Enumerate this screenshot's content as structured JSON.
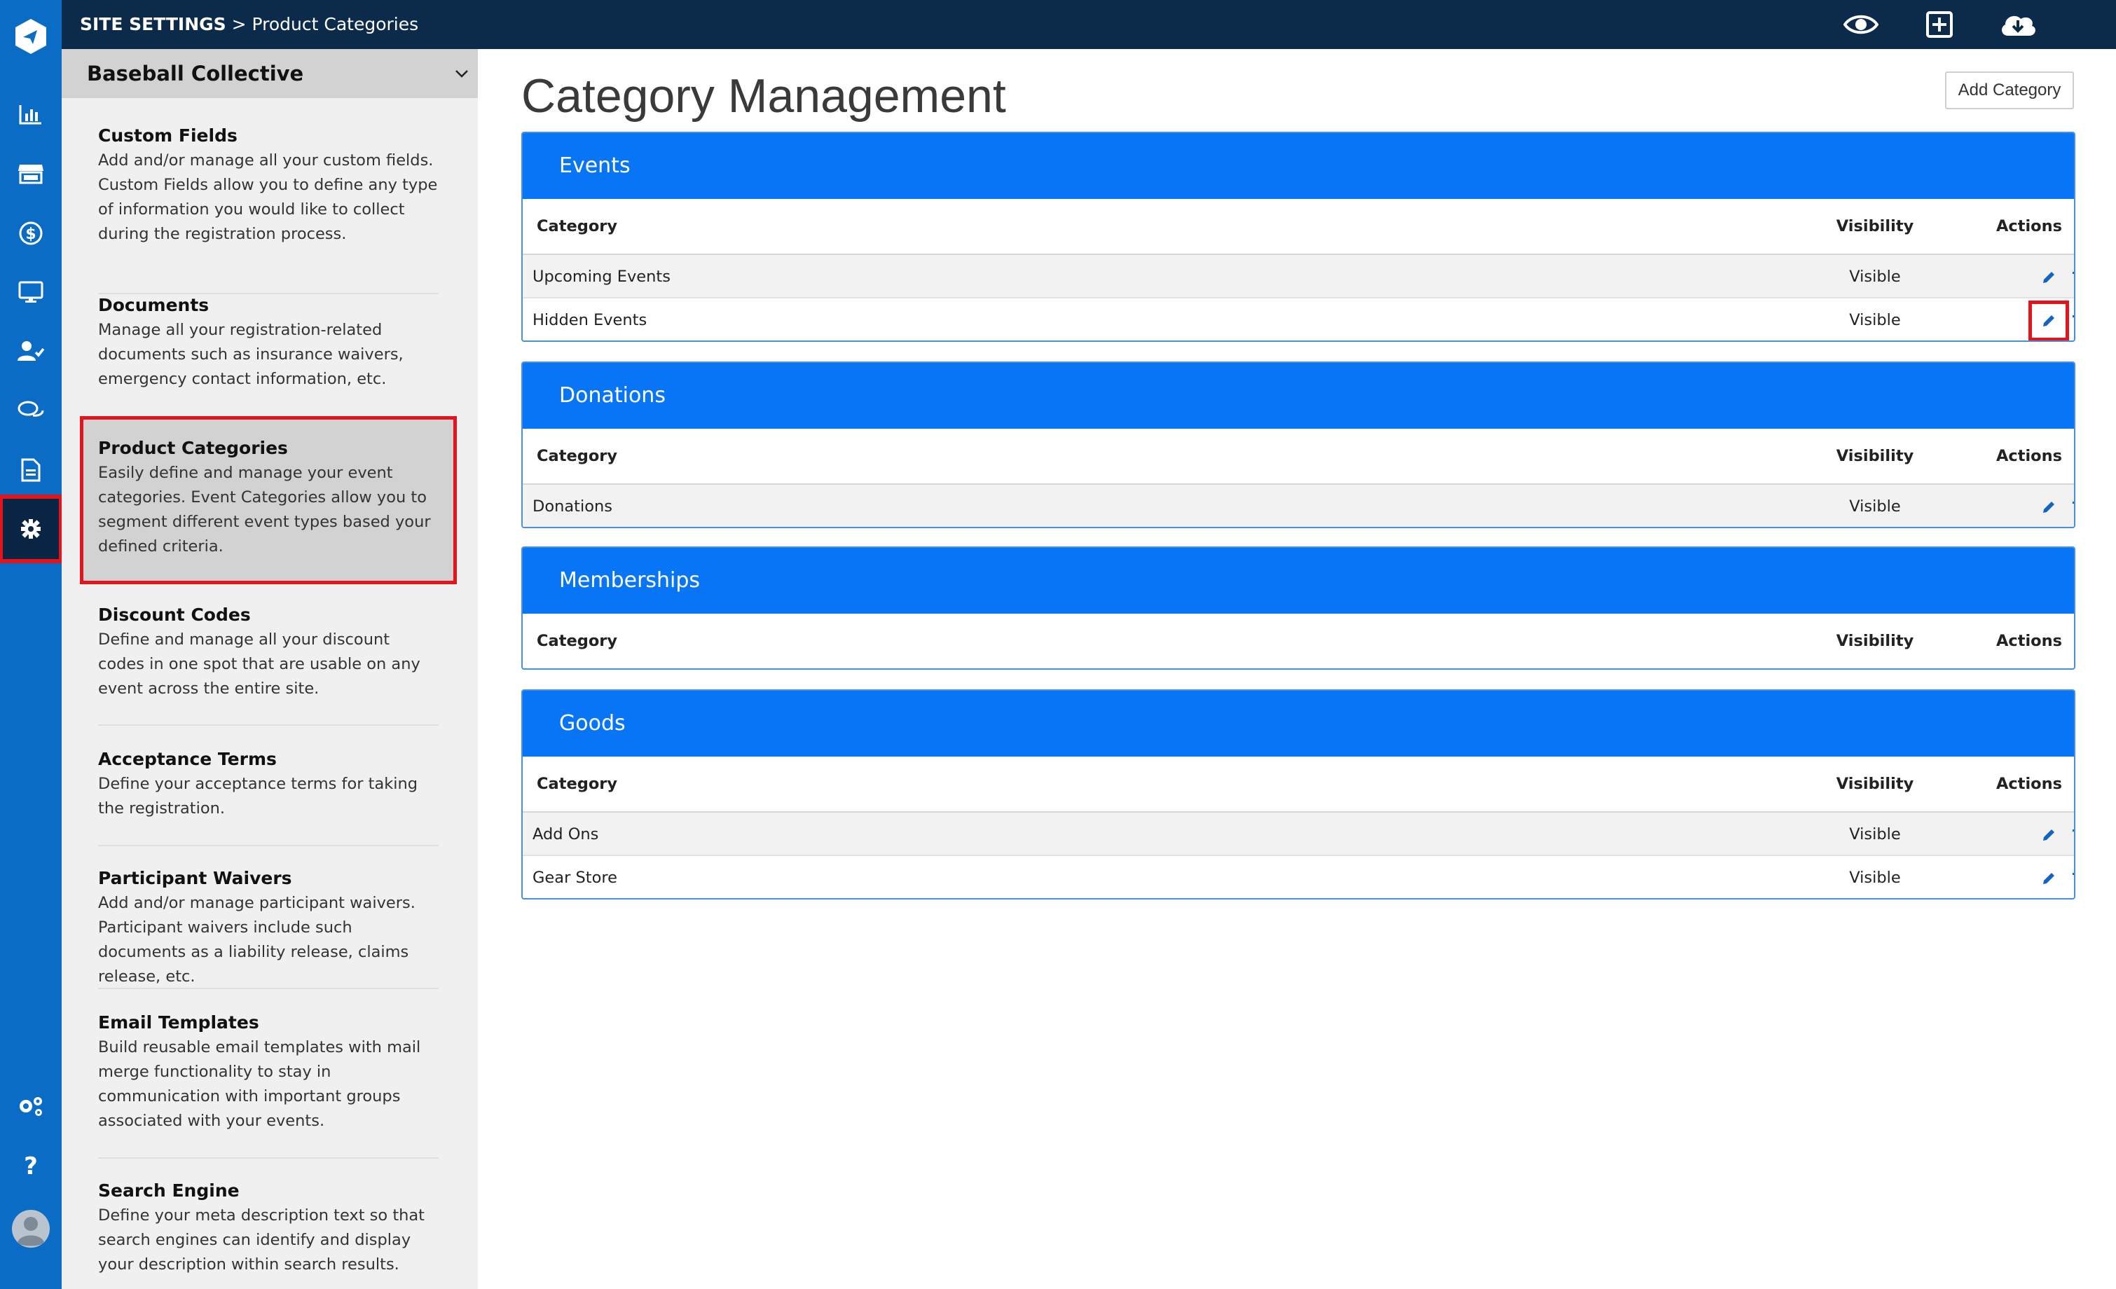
{
  "breadcrumb": {
    "section": "SITE SETTINGS",
    "separator": " > ",
    "page": "Product Categories"
  },
  "rail": {
    "items": [
      "logo-icon",
      "chart-icon",
      "store-icon",
      "dollar-icon",
      "monitor-icon",
      "user-check-icon",
      "chat-icon",
      "document-icon",
      "gear-icon",
      "gears-icon",
      "help-icon",
      "avatar"
    ],
    "active": "gear-icon"
  },
  "panel": {
    "title": "Baseball Collective",
    "settings": [
      {
        "title": "Custom Fields",
        "desc": "Add and/or manage all your custom fields. Custom Fields allow you to define any type of information you would like to collect during the registration process."
      },
      {
        "title": "Documents",
        "desc": "Manage all your registration-related documents such as insurance waivers, emergency contact information, etc."
      },
      {
        "title": "Product Categories",
        "desc": "Easily define and manage your event categories. Event Categories allow you to segment different event types based your defined criteria."
      },
      {
        "title": "Discount Codes",
        "desc": "Define and manage all your discount codes in one spot that are usable on any event across the entire site."
      },
      {
        "title": "Acceptance Terms",
        "desc": "Define your acceptance terms for taking the registration."
      },
      {
        "title": "Participant Waivers",
        "desc": "Add and/or manage participant waivers. Participant waivers include such documents as a liability release, claims release, etc."
      },
      {
        "title": "Email Templates",
        "desc": "Build reusable email templates with mail merge functionality to stay in communication with important groups associated with your events."
      },
      {
        "title": "Search Engine",
        "desc": "Define your meta description text so that search engines can identify and display your description within search results."
      }
    ],
    "active_index": 2
  },
  "main": {
    "title": "Category Management",
    "add_button": "Add Category",
    "columns": {
      "category": "Category",
      "visibility": "Visibility",
      "actions": "Actions"
    },
    "groups": [
      {
        "name": "Events",
        "rows": [
          {
            "category": "Upcoming Events",
            "visibility": "Visible"
          },
          {
            "category": "Hidden Events",
            "visibility": "Visible"
          }
        ]
      },
      {
        "name": "Donations",
        "rows": [
          {
            "category": "Donations",
            "visibility": "Visible"
          }
        ]
      },
      {
        "name": "Memberships",
        "rows": []
      },
      {
        "name": "Goods",
        "rows": [
          {
            "category": "Add Ons",
            "visibility": "Visible"
          },
          {
            "category": "Gear Store",
            "visibility": "Visible"
          }
        ]
      }
    ]
  },
  "colors": {
    "rail": "#0a6cc4",
    "topbar": "#0c2b4b",
    "card_header": "#0875f7",
    "highlight": "#e3141b",
    "action_icon": "#1565c0"
  }
}
